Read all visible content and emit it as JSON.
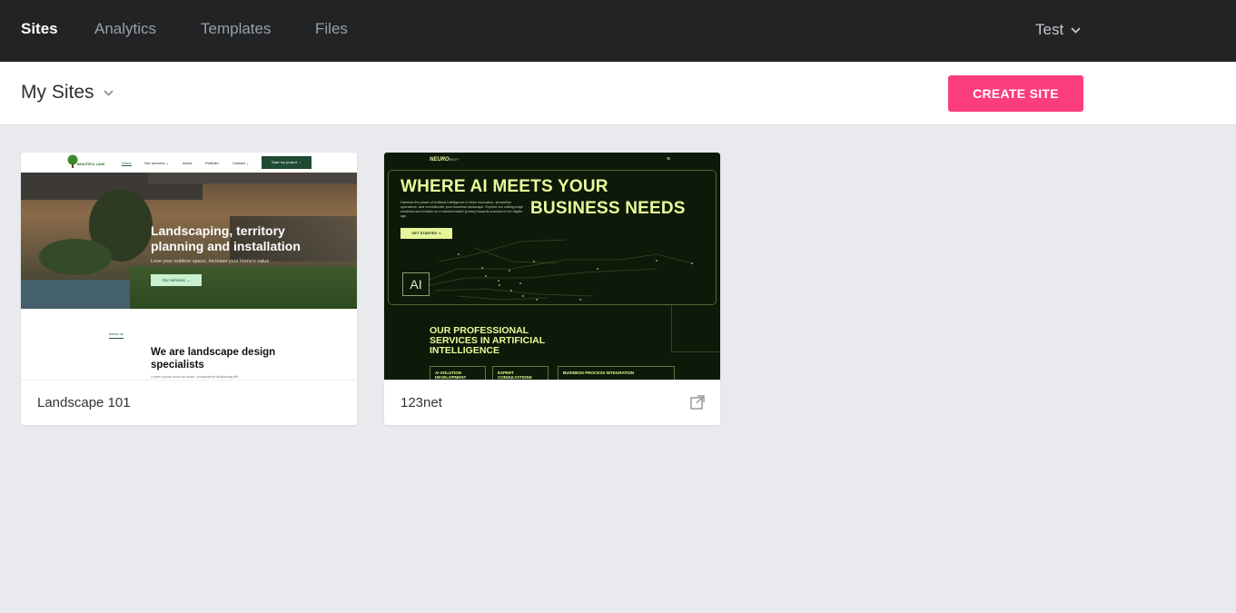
{
  "topnav": {
    "items": [
      {
        "label": "Sites",
        "active": true
      },
      {
        "label": "Analytics",
        "active": false
      },
      {
        "label": "Templates",
        "active": false
      },
      {
        "label": "Files",
        "active": false
      }
    ],
    "user": {
      "label": "Test",
      "icon": "chevron-down-icon"
    }
  },
  "header": {
    "title": "My Sites",
    "title_icon": "chevron-down-icon",
    "create_button": "CREATE SITE",
    "accent": "#fb3c7d"
  },
  "sites": [
    {
      "name": "Landscape 101",
      "preview": {
        "logo_text": "BEAUTIFUL LAND",
        "nav": [
          "Home",
          "Our services ⌄",
          "About",
          "Portfolio",
          "Contact ⌄"
        ],
        "cta": "Start my project →",
        "headline": "Landscaping, territory planning and installation",
        "subline": "Love your outdoor space, increase your home's value",
        "button": "Our services →",
        "about_tag": "About us",
        "about_headline": "We are landscape design specialists",
        "about_text": "Lorem ipsum dolor sit amet, consectetur adipiscing elit."
      }
    },
    {
      "name": "123net",
      "external_link_icon": "external-link-icon",
      "preview": {
        "logo": "NEURO",
        "logo_suffix": "NEXT~",
        "menu_icon": "≡",
        "headline_1": "WHERE AI MEETS YOUR",
        "headline_2": "BUSINESS NEEDS",
        "paragraph": "Harness the power of Artificial Intelligence to drive innovation, streamline operations, and revolutionize your business landscape. Explore our cutting-edge solutions and embark on a transformative journey towards success in the digital age.",
        "button": "GET STARTED ↘",
        "chip": "AI",
        "services_heading": "OUR PROFESSIONAL SERVICES IN ARTIFICIAL INTELLIGENCE",
        "service_boxes": [
          "AI SOLUTION DEVELOPMENT",
          "EXPERT CONSULTATIONS",
          "BUSINESS PROCESS INTEGRATION"
        ]
      }
    }
  ]
}
